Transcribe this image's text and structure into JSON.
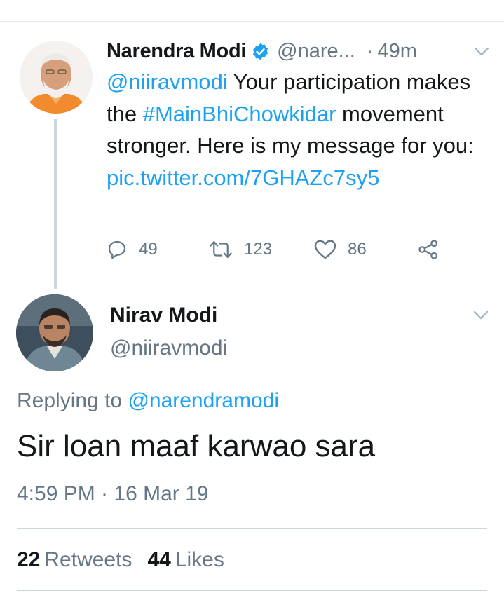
{
  "parent_tweet": {
    "name": "Narendra Modi",
    "handle": "@nare...",
    "separator": "·",
    "time": "49m",
    "text": {
      "mention": "@niiravmodi",
      "part1": " Your participation makes the ",
      "hashtag": "#MainBhiChowkidar",
      "part2": " movement stronger. Here is my message for you: ",
      "link": "pic.twitter.com/7GHAZc7sy5"
    },
    "actions": {
      "replies": "49",
      "retweets": "123",
      "likes": "86"
    }
  },
  "reply_tweet": {
    "name": "Nirav Modi",
    "handle": "@niiravmodi",
    "replying_label": "Replying to ",
    "replying_to": "@narendramodi",
    "text": "Sir loan maaf karwao sara",
    "timestamp": "4:59 PM · 16 Mar 19",
    "retweets_count": "22",
    "retweets_label": "Retweets",
    "likes_count": "44",
    "likes_label": "Likes"
  },
  "colors": {
    "link": "#1da1f2",
    "secondary_text": "#657786",
    "primary_text": "#14171a",
    "divider": "#ccd6dd"
  },
  "icons": {
    "verified": "verified-badge-icon",
    "menu": "chevron-down-icon",
    "reply": "reply-icon",
    "retweet": "retweet-icon",
    "like": "heart-icon",
    "share": "share-icon"
  }
}
